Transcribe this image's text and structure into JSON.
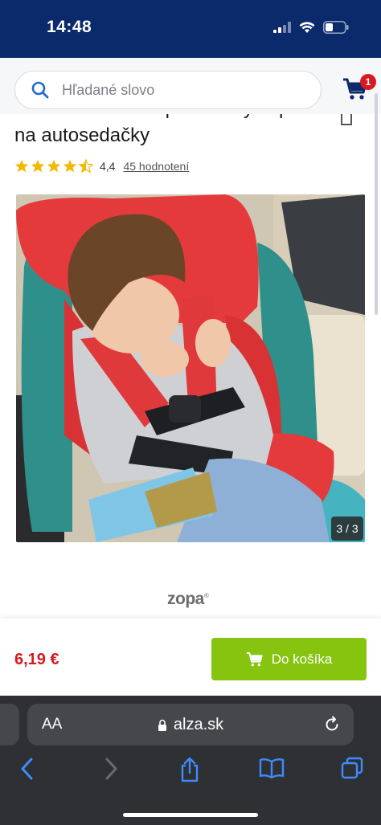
{
  "status_bar": {
    "time": "14:48"
  },
  "search": {
    "placeholder": "Hľadané slovo"
  },
  "cart": {
    "badge_count": "1"
  },
  "product": {
    "title": "ZOPA Zámok bezpečnostných pásov na autosedačky",
    "rating_value": "4,4",
    "rating_count_label": "45 hodnotení",
    "stars": 4.5,
    "image_counter": "3 / 3",
    "brand": "zopa",
    "price": "6,19 €",
    "add_to_cart_label": "Do košíka"
  },
  "browser": {
    "aa_label": "AA",
    "url": "alza.sk"
  },
  "colors": {
    "header_bg": "#0a2a6b",
    "accent_blue": "#1f6ad3",
    "price_red": "#d71921",
    "cart_green": "#86c410",
    "star_yellow": "#f5b800",
    "browser_bg": "#2f3033"
  }
}
